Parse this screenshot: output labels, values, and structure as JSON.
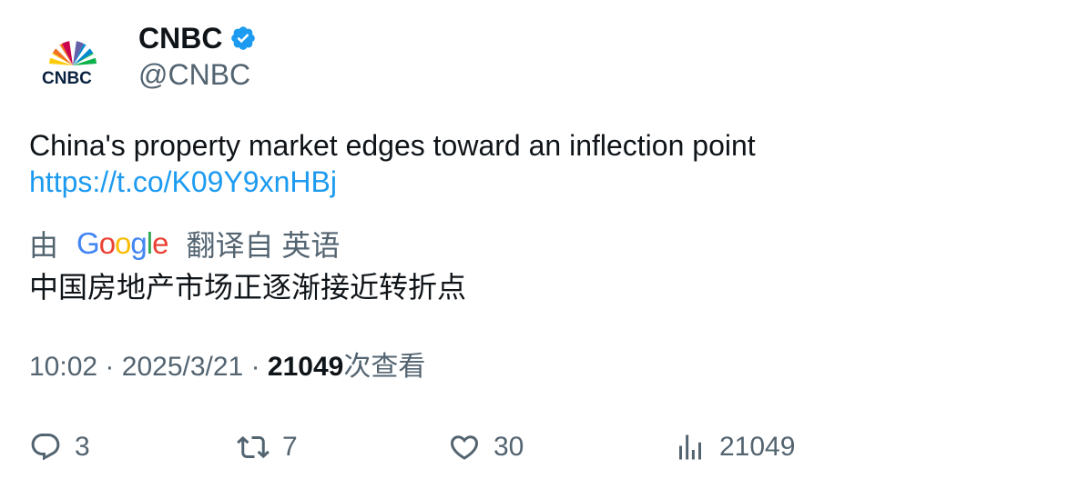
{
  "tweet": {
    "author": {
      "display_name": "CNBC",
      "handle": "@CNBC",
      "verified_icon": "verified-badge-icon",
      "avatar_logo_text": "CNBC"
    },
    "text": "China's property market edges toward an inflection point",
    "link": "https://t.co/K09Y9xnHBj",
    "translation": {
      "prefix": "由",
      "provider_letters": [
        "G",
        "o",
        "o",
        "g",
        "l",
        "e"
      ],
      "suffix": "翻译自 英语",
      "text": "中国房地产市场正逐渐接近转折点"
    },
    "meta": {
      "time": "10:02",
      "separator": "·",
      "date": "2025/3/21",
      "views": "21049",
      "views_label": "次查看"
    },
    "actions": {
      "replies": "3",
      "retweets": "7",
      "likes": "30",
      "views": "21049"
    },
    "colors": {
      "link": "#1d9bf0",
      "secondary_text": "#536471",
      "primary_text": "#0f1419",
      "verified": "#1d9bf0",
      "google": [
        "#4285F4",
        "#EA4335",
        "#FBBC05",
        "#4285F4",
        "#34A853",
        "#EA4335"
      ]
    }
  }
}
